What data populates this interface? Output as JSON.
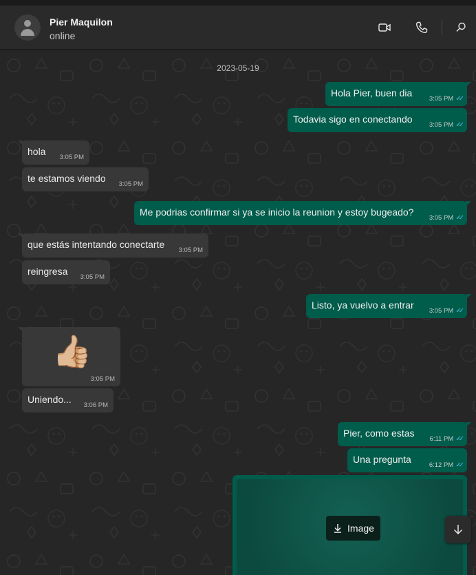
{
  "header": {
    "contact_name": "Pier Maquilon",
    "contact_status": "online",
    "icons": [
      "video-call-icon",
      "voice-call-icon",
      "search-icon"
    ]
  },
  "chat": {
    "date_separator": "2023-05-19",
    "messages": [
      {
        "direction": "out",
        "text": "Hola Pier, buen dia",
        "time": "3:05 PM",
        "read": true
      },
      {
        "direction": "out",
        "text": "Todavia sigo en conectando",
        "time": "3:05 PM",
        "read": true
      },
      {
        "direction": "in",
        "text": "hola",
        "time": "3:05 PM"
      },
      {
        "direction": "in",
        "text": "te estamos viendo",
        "time": "3:05 PM"
      },
      {
        "direction": "out",
        "text": "Me podrias confirmar si ya se inicio la reunion y estoy bugeado?",
        "time": "3:05 PM",
        "read": true
      },
      {
        "direction": "in",
        "text": "que estás intentando conectarte",
        "time": "3:05 PM"
      },
      {
        "direction": "in",
        "text": "reingresa",
        "time": "3:05 PM"
      },
      {
        "direction": "out",
        "text": "Listo, ya vuelvo a entrar",
        "time": "3:05 PM",
        "read": true
      },
      {
        "direction": "in",
        "type": "emoji",
        "emoji": "👍🏼",
        "time": "3:05 PM"
      },
      {
        "direction": "in",
        "text": "Uniendo...",
        "time": "3:06 PM"
      },
      {
        "direction": "out",
        "text": "Pier, como estas",
        "time": "6:11 PM",
        "read": true
      },
      {
        "direction": "out",
        "text": "Una pregunta",
        "time": "6:12 PM",
        "read": true
      },
      {
        "direction": "out",
        "type": "image",
        "button_label": "Image"
      }
    ],
    "colors": {
      "outgoing_bubble": "#005c4b",
      "incoming_bubble": "#383838",
      "read_ticks": "#53bdeb",
      "background": "#262626"
    }
  }
}
